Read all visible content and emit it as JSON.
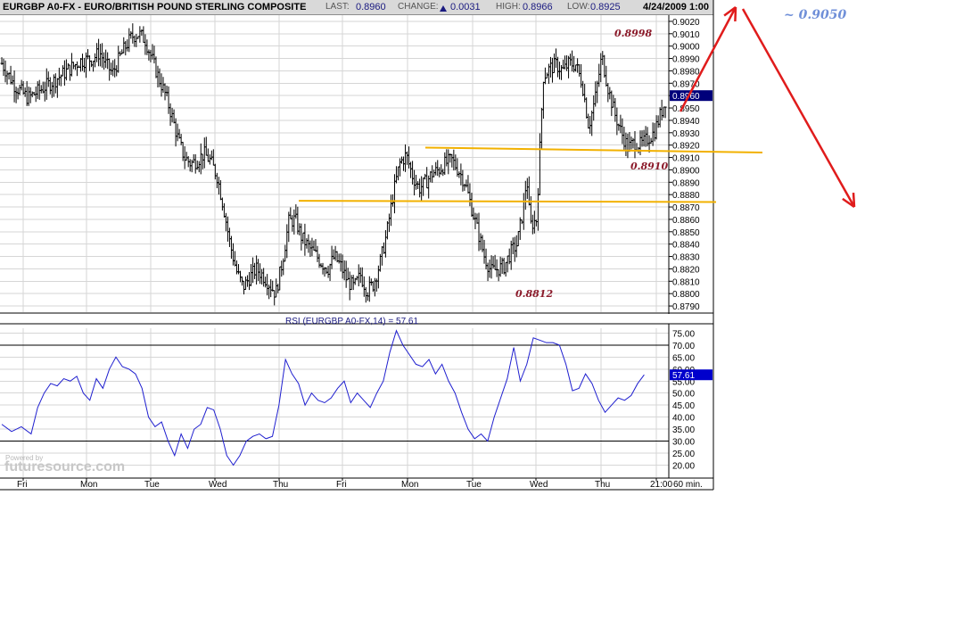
{
  "header": {
    "title": "EURGBP A0-FX - EURO/BRITISH POUND STERLING COMPOSITE",
    "last_label": "LAST:",
    "last_value": "0.8960",
    "change_label": "CHANGE:",
    "change_value": "0.0031",
    "high_label": "HIGH:",
    "high_value": "0.8966",
    "low_label": "LOW:",
    "low_value": "0.8925",
    "datetime": "4/24/2009 1:00"
  },
  "annotations": {
    "high_note": "0.8998",
    "mid_note": "0.8910",
    "low_note": "0.8812",
    "target_note": "~ 0.9050"
  },
  "colors": {
    "price": "#000000",
    "rsi": "#1f1fcf",
    "support": "#f2b100",
    "arrow": "#e01c1c",
    "last_box": "#00007a",
    "rsi_box": "#0000cc"
  },
  "footer": {
    "watermark_small": "Powered by",
    "watermark_big": "futuresource.com"
  },
  "chart_data": [
    {
      "type": "bar",
      "subtype": "ohlc",
      "title": "EURGBP A0-FX - EURO/BRITISH POUND STERLING COMPOSITE",
      "interval": "60 min.",
      "ylim": [
        0.8785,
        0.9025
      ],
      "y_ticks": [
        "0.9020",
        "0.9010",
        "0.9000",
        "0.8990",
        "0.8980",
        "0.8970",
        "0.8960",
        "0.8950",
        "0.8940",
        "0.8930",
        "0.8920",
        "0.8910",
        "0.8900",
        "0.8890",
        "0.8880",
        "0.8870",
        "0.8860",
        "0.8850",
        "0.8840",
        "0.8830",
        "0.8820",
        "0.8810",
        "0.8800",
        "0.8790"
      ],
      "x_ticks": [
        "Fri",
        "Mon",
        "Tue",
        "Wed",
        "Thu",
        "Fri",
        "Mon",
        "Tue",
        "Wed",
        "Thu",
        "21:00",
        "60 min."
      ],
      "last_value": "0.8960",
      "close_path": [
        [
          0,
          0.8986
        ],
        [
          4,
          0.8968
        ],
        [
          8,
          0.8958
        ],
        [
          12,
          0.8965
        ],
        [
          16,
          0.8972
        ],
        [
          20,
          0.898
        ],
        [
          24,
          0.8988
        ],
        [
          28,
          0.899
        ],
        [
          30,
          0.8995
        ],
        [
          32,
          0.8985
        ],
        [
          34,
          0.8978
        ],
        [
          36,
          0.899
        ],
        [
          38,
          0.9
        ],
        [
          40,
          0.9008
        ],
        [
          42,
          0.901
        ],
        [
          44,
          0.9005
        ],
        [
          46,
          0.899
        ],
        [
          48,
          0.8975
        ],
        [
          50,
          0.8962
        ],
        [
          52,
          0.8945
        ],
        [
          54,
          0.8925
        ],
        [
          56,
          0.891
        ],
        [
          58,
          0.8905
        ],
        [
          60,
          0.8908
        ],
        [
          62,
          0.8913
        ],
        [
          64,
          0.8907
        ],
        [
          66,
          0.8895
        ],
        [
          68,
          0.887
        ],
        [
          70,
          0.884
        ],
        [
          72,
          0.8818
        ],
        [
          74,
          0.8805
        ],
        [
          76,
          0.8813
        ],
        [
          78,
          0.882
        ],
        [
          80,
          0.8815
        ],
        [
          82,
          0.8808
        ],
        [
          84,
          0.88
        ],
        [
          86,
          0.8825
        ],
        [
          88,
          0.8858
        ],
        [
          90,
          0.886
        ],
        [
          92,
          0.8845
        ],
        [
          94,
          0.8838
        ],
        [
          96,
          0.8832
        ],
        [
          98,
          0.8825
        ],
        [
          100,
          0.882
        ],
        [
          102,
          0.883
        ],
        [
          104,
          0.8822
        ],
        [
          106,
          0.881
        ],
        [
          108,
          0.8805
        ],
        [
          110,
          0.8815
        ],
        [
          112,
          0.8802
        ],
        [
          114,
          0.8808
        ],
        [
          116,
          0.8825
        ],
        [
          118,
          0.8848
        ],
        [
          120,
          0.888
        ],
        [
          122,
          0.8905
        ],
        [
          124,
          0.8912
        ],
        [
          126,
          0.8895
        ],
        [
          128,
          0.8885
        ],
        [
          130,
          0.889
        ],
        [
          132,
          0.8897
        ],
        [
          134,
          0.89
        ],
        [
          136,
          0.8905
        ],
        [
          138,
          0.8908
        ],
        [
          140,
          0.89
        ],
        [
          142,
          0.889
        ],
        [
          144,
          0.887
        ],
        [
          146,
          0.885
        ],
        [
          148,
          0.883
        ],
        [
          150,
          0.8818
        ],
        [
          152,
          0.882
        ],
        [
          154,
          0.8822
        ],
        [
          156,
          0.8833
        ],
        [
          158,
          0.884
        ],
        [
          160,
          0.887
        ],
        [
          161,
          0.8895
        ],
        [
          162,
          0.8855
        ],
        [
          164,
          0.886
        ],
        [
          166,
          0.8975
        ],
        [
          168,
          0.8982
        ],
        [
          170,
          0.8985
        ],
        [
          172,
          0.898
        ],
        [
          174,
          0.8986
        ],
        [
          176,
          0.8985
        ],
        [
          178,
          0.897
        ],
        [
          180,
          0.8935
        ],
        [
          182,
          0.8958
        ],
        [
          184,
          0.8992
        ],
        [
          186,
          0.8965
        ],
        [
          188,
          0.8945
        ],
        [
          190,
          0.893
        ],
        [
          192,
          0.8918
        ],
        [
          194,
          0.8922
        ],
        [
          196,
          0.892
        ],
        [
          198,
          0.8925
        ],
        [
          200,
          0.893
        ],
        [
          202,
          0.8945
        ],
        [
          204,
          0.896
        ]
      ],
      "support_lines": [
        {
          "y": [
            0.8918,
            0.8914
          ]
        },
        {
          "y": [
            0.8875,
            0.8874
          ]
        }
      ]
    },
    {
      "type": "line",
      "title": "RSI (EURGBP A0-FX,14) = 57.61",
      "ylim": [
        15,
        77
      ],
      "y_ticks": [
        "75.00",
        "70.00",
        "65.00",
        "60.00",
        "55.00",
        "50.00",
        "45.00",
        "40.00",
        "35.00",
        "30.00",
        "25.00",
        "20.00"
      ],
      "reference_lines": [
        70,
        30
      ],
      "last_value": "57.61",
      "values": [
        [
          0,
          37
        ],
        [
          3,
          34
        ],
        [
          6,
          36
        ],
        [
          9,
          33
        ],
        [
          11,
          44
        ],
        [
          13,
          50
        ],
        [
          15,
          54
        ],
        [
          17,
          53
        ],
        [
          19,
          56
        ],
        [
          21,
          55
        ],
        [
          23,
          57
        ],
        [
          25,
          50
        ],
        [
          27,
          47
        ],
        [
          29,
          56
        ],
        [
          31,
          52
        ],
        [
          33,
          60
        ],
        [
          35,
          65
        ],
        [
          37,
          61
        ],
        [
          39,
          60
        ],
        [
          41,
          58
        ],
        [
          43,
          52
        ],
        [
          45,
          40
        ],
        [
          47,
          36
        ],
        [
          49,
          38
        ],
        [
          51,
          30
        ],
        [
          53,
          24
        ],
        [
          55,
          33
        ],
        [
          57,
          27
        ],
        [
          59,
          35
        ],
        [
          61,
          37
        ],
        [
          63,
          44
        ],
        [
          65,
          43
        ],
        [
          67,
          35
        ],
        [
          69,
          24
        ],
        [
          71,
          20
        ],
        [
          73,
          24
        ],
        [
          75,
          30
        ],
        [
          77,
          32
        ],
        [
          79,
          33
        ],
        [
          81,
          31
        ],
        [
          83,
          32
        ],
        [
          85,
          45
        ],
        [
          87,
          64
        ],
        [
          89,
          58
        ],
        [
          91,
          54
        ],
        [
          93,
          45
        ],
        [
          95,
          50
        ],
        [
          97,
          47
        ],
        [
          99,
          46
        ],
        [
          101,
          48
        ],
        [
          103,
          52
        ],
        [
          105,
          55
        ],
        [
          107,
          46
        ],
        [
          109,
          50
        ],
        [
          111,
          47
        ],
        [
          113,
          44
        ],
        [
          115,
          50
        ],
        [
          117,
          55
        ],
        [
          119,
          67
        ],
        [
          121,
          76
        ],
        [
          123,
          70
        ],
        [
          125,
          66
        ],
        [
          127,
          62
        ],
        [
          129,
          61
        ],
        [
          131,
          64
        ],
        [
          133,
          58
        ],
        [
          135,
          62
        ],
        [
          137,
          55
        ],
        [
          139,
          50
        ],
        [
          141,
          42
        ],
        [
          143,
          35
        ],
        [
          145,
          31
        ],
        [
          147,
          33
        ],
        [
          149,
          30
        ],
        [
          151,
          40
        ],
        [
          153,
          48
        ],
        [
          155,
          56
        ],
        [
          157,
          69
        ],
        [
          159,
          55
        ],
        [
          161,
          62
        ],
        [
          163,
          73
        ],
        [
          165,
          72
        ],
        [
          167,
          71
        ],
        [
          169,
          71
        ],
        [
          171,
          70
        ],
        [
          173,
          62
        ],
        [
          175,
          51
        ],
        [
          177,
          52
        ],
        [
          179,
          58
        ],
        [
          181,
          54
        ],
        [
          183,
          47
        ],
        [
          185,
          42
        ],
        [
          187,
          45
        ],
        [
          189,
          48
        ],
        [
          191,
          47
        ],
        [
          193,
          49
        ],
        [
          195,
          54
        ],
        [
          197,
          57.61
        ]
      ]
    }
  ]
}
